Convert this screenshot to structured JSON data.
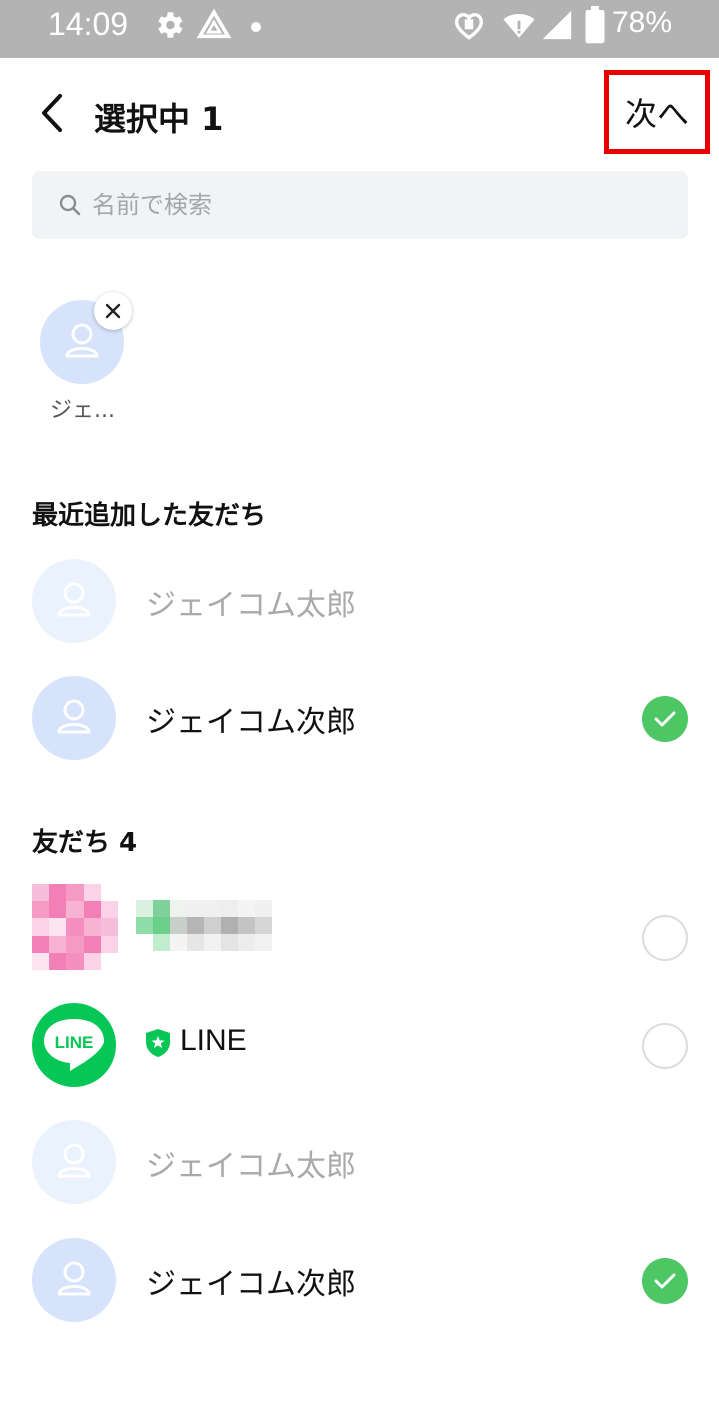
{
  "status_bar": {
    "time": "14:09",
    "battery": "78%",
    "icons": [
      "gear-icon",
      "drive-icon",
      "dot-icon",
      "heart-lock-icon",
      "wifi-icon",
      "cell-signal-icon",
      "battery-icon"
    ]
  },
  "header": {
    "title": "選択中 1",
    "next_label": "次へ"
  },
  "search": {
    "placeholder": "名前で検索"
  },
  "selected": [
    {
      "name": "ジェ..."
    }
  ],
  "recent": {
    "title": "最近追加した友だち",
    "items": [
      {
        "name": "ジェイコム太郎",
        "state": "disabled"
      },
      {
        "name": "ジェイコム次郎",
        "state": "checked"
      }
    ]
  },
  "friends": {
    "title": "友だち 4",
    "items": [
      {
        "name": "",
        "state": "unchecked",
        "avatar": "mosaic"
      },
      {
        "name": "LINE",
        "state": "unchecked",
        "avatar": "line-logo",
        "logo_text": "LINE"
      },
      {
        "name": "ジェイコム太郎",
        "state": "disabled"
      },
      {
        "name": "ジェイコム次郎",
        "state": "checked"
      }
    ]
  },
  "colors": {
    "accent_green": "#4cc764",
    "line_green": "#06c755",
    "highlight_red": "#e80000",
    "avatar_blue": "#d6e3fb"
  }
}
